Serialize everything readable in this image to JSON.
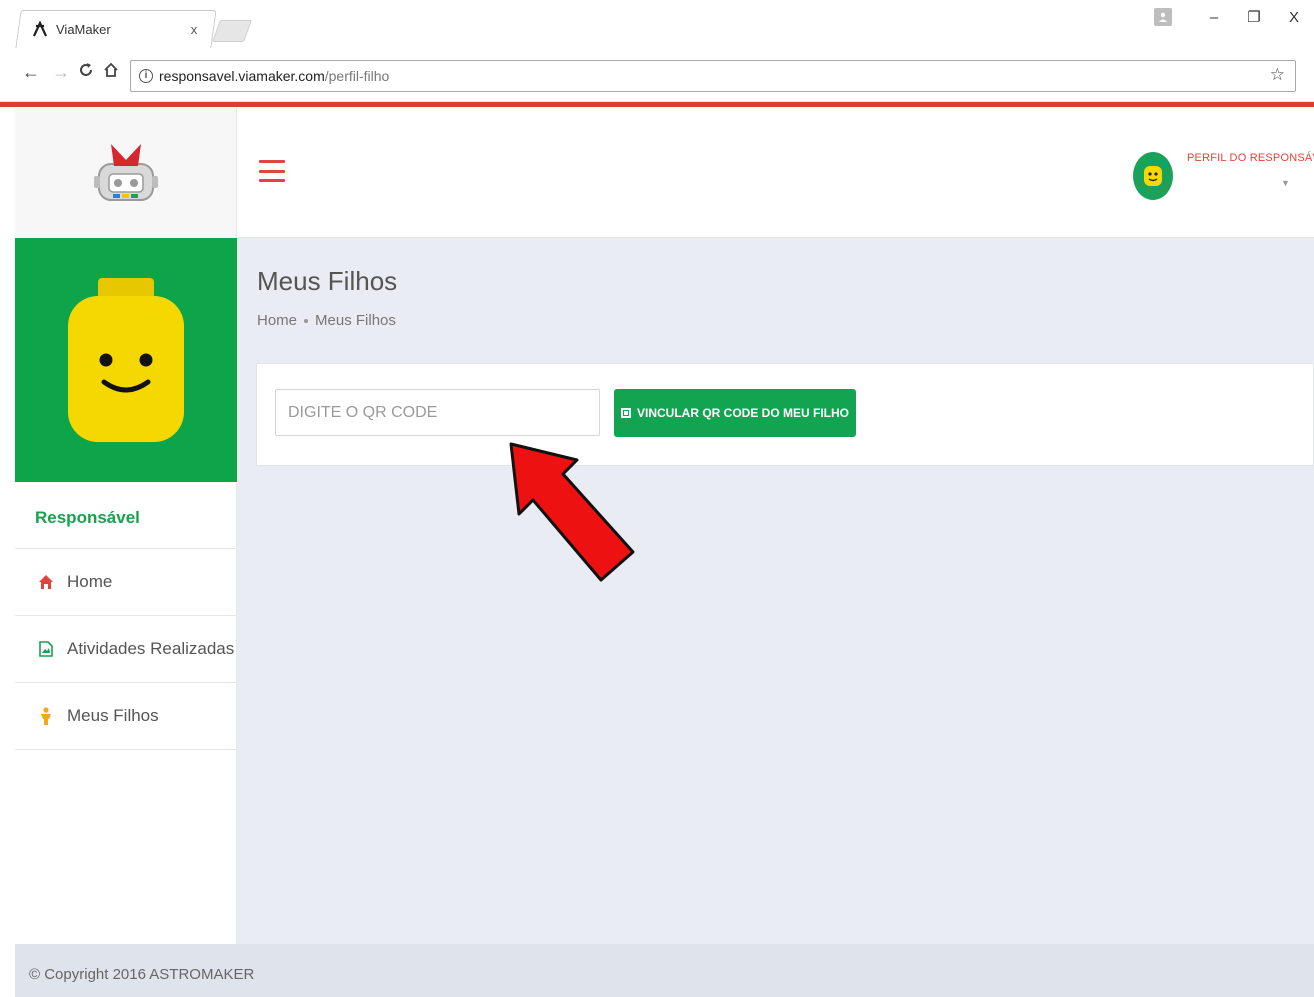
{
  "browser": {
    "tab_title": "ViaMaker",
    "tab_close": "x",
    "url_host": "responsavel.viamaker.com",
    "url_path": "/perfil-filho",
    "window_buttons": [
      "–",
      "❐",
      "X"
    ]
  },
  "header": {
    "profile_label": "PERFIL DO RESPONSÁVEL"
  },
  "sidebar": {
    "role_label": "Responsável",
    "items": [
      {
        "label": "Home",
        "icon": "home-icon",
        "color": "#e0443b"
      },
      {
        "label": "Atividades Realizadas",
        "icon": "image-file-icon",
        "color": "#17a24e"
      },
      {
        "label": "Meus Filhos",
        "icon": "child-figure-icon",
        "color": "#f5a623"
      }
    ]
  },
  "main": {
    "page_title": "Meus Filhos",
    "breadcrumb": [
      "Home",
      "Meus Filhos"
    ],
    "qr_input_placeholder": "DIGITE O QR CODE",
    "qr_input_value": "",
    "qr_button_label": "VINCULAR QR CODE DO MEU FILHO"
  },
  "footer": {
    "copyright": "© Copyright 2016 ASTROMAKER"
  },
  "colors": {
    "accent_red": "#dc3b36",
    "brand_green": "#13a451",
    "main_bg": "#e9ecf3"
  }
}
